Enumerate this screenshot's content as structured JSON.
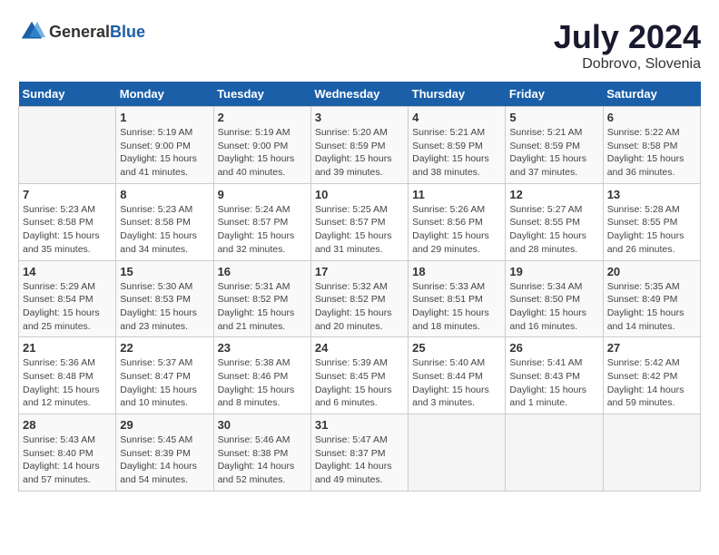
{
  "header": {
    "logo_general": "General",
    "logo_blue": "Blue",
    "title": "July 2024",
    "subtitle": "Dobrovo, Slovenia"
  },
  "calendar": {
    "days_of_week": [
      "Sunday",
      "Monday",
      "Tuesday",
      "Wednesday",
      "Thursday",
      "Friday",
      "Saturday"
    ],
    "weeks": [
      [
        {
          "day": "",
          "info": ""
        },
        {
          "day": "1",
          "info": "Sunrise: 5:19 AM\nSunset: 9:00 PM\nDaylight: 15 hours\nand 41 minutes."
        },
        {
          "day": "2",
          "info": "Sunrise: 5:19 AM\nSunset: 9:00 PM\nDaylight: 15 hours\nand 40 minutes."
        },
        {
          "day": "3",
          "info": "Sunrise: 5:20 AM\nSunset: 8:59 PM\nDaylight: 15 hours\nand 39 minutes."
        },
        {
          "day": "4",
          "info": "Sunrise: 5:21 AM\nSunset: 8:59 PM\nDaylight: 15 hours\nand 38 minutes."
        },
        {
          "day": "5",
          "info": "Sunrise: 5:21 AM\nSunset: 8:59 PM\nDaylight: 15 hours\nand 37 minutes."
        },
        {
          "day": "6",
          "info": "Sunrise: 5:22 AM\nSunset: 8:58 PM\nDaylight: 15 hours\nand 36 minutes."
        }
      ],
      [
        {
          "day": "7",
          "info": "Sunrise: 5:23 AM\nSunset: 8:58 PM\nDaylight: 15 hours\nand 35 minutes."
        },
        {
          "day": "8",
          "info": "Sunrise: 5:23 AM\nSunset: 8:58 PM\nDaylight: 15 hours\nand 34 minutes."
        },
        {
          "day": "9",
          "info": "Sunrise: 5:24 AM\nSunset: 8:57 PM\nDaylight: 15 hours\nand 32 minutes."
        },
        {
          "day": "10",
          "info": "Sunrise: 5:25 AM\nSunset: 8:57 PM\nDaylight: 15 hours\nand 31 minutes."
        },
        {
          "day": "11",
          "info": "Sunrise: 5:26 AM\nSunset: 8:56 PM\nDaylight: 15 hours\nand 29 minutes."
        },
        {
          "day": "12",
          "info": "Sunrise: 5:27 AM\nSunset: 8:55 PM\nDaylight: 15 hours\nand 28 minutes."
        },
        {
          "day": "13",
          "info": "Sunrise: 5:28 AM\nSunset: 8:55 PM\nDaylight: 15 hours\nand 26 minutes."
        }
      ],
      [
        {
          "day": "14",
          "info": "Sunrise: 5:29 AM\nSunset: 8:54 PM\nDaylight: 15 hours\nand 25 minutes."
        },
        {
          "day": "15",
          "info": "Sunrise: 5:30 AM\nSunset: 8:53 PM\nDaylight: 15 hours\nand 23 minutes."
        },
        {
          "day": "16",
          "info": "Sunrise: 5:31 AM\nSunset: 8:52 PM\nDaylight: 15 hours\nand 21 minutes."
        },
        {
          "day": "17",
          "info": "Sunrise: 5:32 AM\nSunset: 8:52 PM\nDaylight: 15 hours\nand 20 minutes."
        },
        {
          "day": "18",
          "info": "Sunrise: 5:33 AM\nSunset: 8:51 PM\nDaylight: 15 hours\nand 18 minutes."
        },
        {
          "day": "19",
          "info": "Sunrise: 5:34 AM\nSunset: 8:50 PM\nDaylight: 15 hours\nand 16 minutes."
        },
        {
          "day": "20",
          "info": "Sunrise: 5:35 AM\nSunset: 8:49 PM\nDaylight: 15 hours\nand 14 minutes."
        }
      ],
      [
        {
          "day": "21",
          "info": "Sunrise: 5:36 AM\nSunset: 8:48 PM\nDaylight: 15 hours\nand 12 minutes."
        },
        {
          "day": "22",
          "info": "Sunrise: 5:37 AM\nSunset: 8:47 PM\nDaylight: 15 hours\nand 10 minutes."
        },
        {
          "day": "23",
          "info": "Sunrise: 5:38 AM\nSunset: 8:46 PM\nDaylight: 15 hours\nand 8 minutes."
        },
        {
          "day": "24",
          "info": "Sunrise: 5:39 AM\nSunset: 8:45 PM\nDaylight: 15 hours\nand 6 minutes."
        },
        {
          "day": "25",
          "info": "Sunrise: 5:40 AM\nSunset: 8:44 PM\nDaylight: 15 hours\nand 3 minutes."
        },
        {
          "day": "26",
          "info": "Sunrise: 5:41 AM\nSunset: 8:43 PM\nDaylight: 15 hours\nand 1 minute."
        },
        {
          "day": "27",
          "info": "Sunrise: 5:42 AM\nSunset: 8:42 PM\nDaylight: 14 hours\nand 59 minutes."
        }
      ],
      [
        {
          "day": "28",
          "info": "Sunrise: 5:43 AM\nSunset: 8:40 PM\nDaylight: 14 hours\nand 57 minutes."
        },
        {
          "day": "29",
          "info": "Sunrise: 5:45 AM\nSunset: 8:39 PM\nDaylight: 14 hours\nand 54 minutes."
        },
        {
          "day": "30",
          "info": "Sunrise: 5:46 AM\nSunset: 8:38 PM\nDaylight: 14 hours\nand 52 minutes."
        },
        {
          "day": "31",
          "info": "Sunrise: 5:47 AM\nSunset: 8:37 PM\nDaylight: 14 hours\nand 49 minutes."
        },
        {
          "day": "",
          "info": ""
        },
        {
          "day": "",
          "info": ""
        },
        {
          "day": "",
          "info": ""
        }
      ]
    ]
  }
}
